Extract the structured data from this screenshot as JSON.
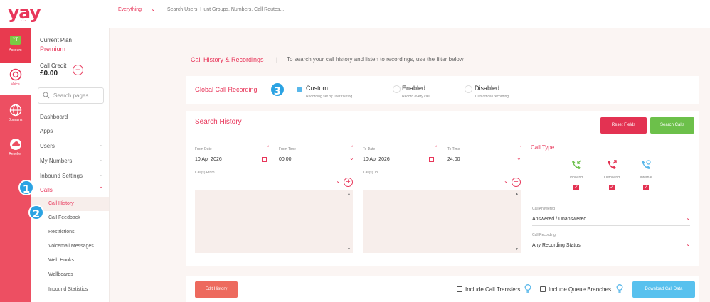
{
  "header": {
    "logo": "yay",
    "logo_dots": "•••",
    "search_scope": "Everything",
    "search_placeholder": "Search Users, Hunt Groups, Numbers, Call Routes..."
  },
  "rail": {
    "account_badge": "YT",
    "items": [
      {
        "label": "Account"
      },
      {
        "label": "Voice"
      },
      {
        "label": "Domains"
      },
      {
        "label": "Reseller"
      }
    ]
  },
  "sidebar": {
    "plan_label": "Current Plan",
    "plan_value": "Premium",
    "credit_label": "Call Credit",
    "credit_value": "£0.00",
    "search_placeholder": "Search pages...",
    "nav": [
      {
        "label": "Dashboard"
      },
      {
        "label": "Apps"
      },
      {
        "label": "Users"
      },
      {
        "label": "My Numbers"
      },
      {
        "label": "Inbound Settings"
      },
      {
        "label": "Calls"
      }
    ],
    "sub": [
      {
        "label": "Call History"
      },
      {
        "label": "Call Feedback"
      },
      {
        "label": "Restrictions"
      },
      {
        "label": "Voicemail Messages"
      },
      {
        "label": "Web Hooks"
      },
      {
        "label": "Wallboards"
      },
      {
        "label": "Inbound Statistics"
      }
    ]
  },
  "steps": [
    "1",
    "2",
    "3"
  ],
  "main": {
    "breadcrumb": "Call History & Recordings",
    "separator": "|",
    "help": "To search your call history and listen to recordings, use the filter below",
    "recording": {
      "title": "Global Call Recording",
      "options": [
        {
          "title": "Custom",
          "sub": "Recording set by user/routing"
        },
        {
          "title": "Enabled",
          "sub": "Record every call"
        },
        {
          "title": "Disabled",
          "sub": "Turn off call recording"
        }
      ]
    },
    "search": {
      "title": "Search History",
      "reset_label": "Reset Fields",
      "search_label": "Search Calls",
      "from_date_label": "From Date",
      "from_date_value": "10 Apr 2026",
      "from_time_label": "From Time",
      "from_time_value": "00:00",
      "to_date_label": "To Date",
      "to_date_value": "10 Apr 2026",
      "to_time_label": "To Time",
      "to_time_value": "24:00",
      "required_mark": "*",
      "calls_from_label": "Call(s) From",
      "calls_to_label": "Call(s) To",
      "call_type_title": "Call Type",
      "call_types": [
        {
          "label": "Inbound",
          "color": "#6cc04a"
        },
        {
          "label": "Outbound",
          "color": "#e33252"
        },
        {
          "label": "Internal",
          "color": "#58b7ea"
        }
      ],
      "answered_label": "Call Answered",
      "answered_value": "Answered / Unanswered",
      "recording_label": "Call Recording",
      "recording_value": "Any Recording Status"
    },
    "bottom": {
      "edit_label": "Edit History",
      "transfers_label": "Include Call Transfers",
      "queue_label": "Include Queue Branches",
      "download_label": "Download Call Data"
    }
  },
  "colors": {
    "brand": "#e8365a",
    "rail": "#ed4f62",
    "accent_blue": "#2ba3e3",
    "green": "#6cc04a"
  }
}
